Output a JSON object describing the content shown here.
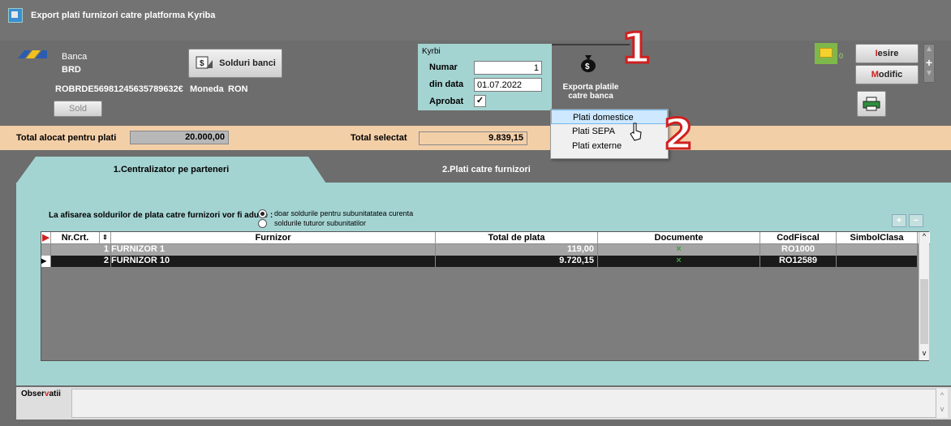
{
  "window": {
    "title": "Export plati furnizori catre platforma Kyriba"
  },
  "bank": {
    "label": "Banca",
    "name": "BRD",
    "solduri_button": "Solduri banci",
    "iban": "ROBRDE56981245635789632€",
    "moneda_label": "Moneda",
    "moneda_value": "RON",
    "sold_button": "Sold"
  },
  "kyriba": {
    "title": "Kyrbi",
    "numar_label": "Numar",
    "numar_value": "1",
    "data_label": "din data",
    "data_value": "01.07.2022",
    "aprobat_label": "Aprobat",
    "aprobat_check": "✓"
  },
  "export": {
    "label_line1": "Exporta platile",
    "label_line2": "catre banca",
    "menu": [
      "Plati domestice",
      "Plati SEPA",
      "Plati externe"
    ]
  },
  "annotations": {
    "one": "1",
    "two": "2"
  },
  "side_buttons": {
    "iesire_prefix": "I",
    "iesire_rest": "esire",
    "modific_prefix": "M",
    "modific_rest": "odific",
    "folder_count": "0"
  },
  "totals": {
    "alocat_label": "Total alocat pentru plati",
    "alocat_value": "20.000,00",
    "selectat_label": "Total selectat",
    "selectat_value": "9.839,15"
  },
  "tabs": [
    "1.Centralizator pe parteneri",
    "2.Plati catre furnizori"
  ],
  "options": {
    "question": "La afisarea soldurilor de plata catre furnizori vor fi aduse :",
    "opt1": "doar soldurile pentru subunitatatea curenta",
    "opt2": "soldurile  tuturor subunitatilor"
  },
  "grid": {
    "headers": [
      "Nr.Crt.",
      "Furnizor",
      "Total de plata",
      "Documente",
      "CodFiscal",
      "SimbolClasa"
    ],
    "rows": [
      {
        "nr": "1",
        "furnizor": "FURNIZOR 1",
        "total": "119,00",
        "doc": "×",
        "cod": "RO1000",
        "simbol": ""
      },
      {
        "nr": "2",
        "furnizor": "FURNIZOR 10",
        "total": "9.720,15",
        "doc": "×",
        "cod": "RO12589",
        "simbol": ""
      }
    ]
  },
  "observatii": {
    "prefix": "Obser",
    "highlight": "v",
    "rest": "atii"
  },
  "colors": {
    "panel": "#a4d4d2",
    "totalbar": "#f3cfa8",
    "accent_red": "#d02020"
  }
}
